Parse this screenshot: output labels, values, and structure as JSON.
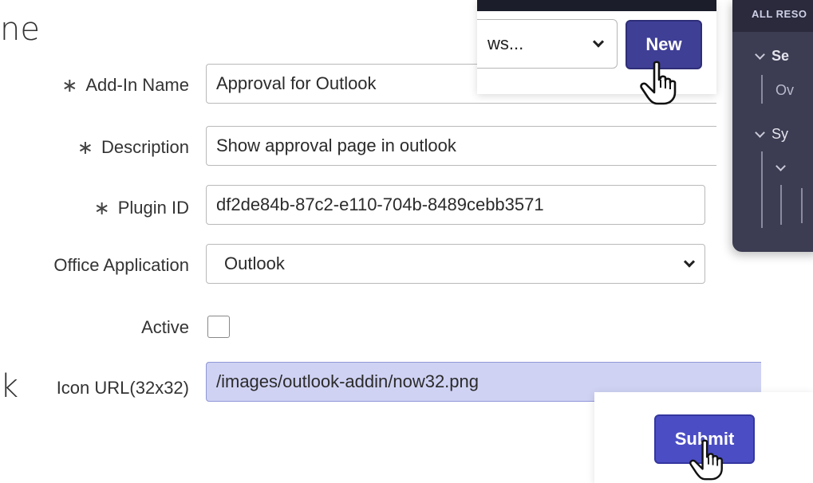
{
  "background": {
    "word_top": "ne",
    "word_mid": "k"
  },
  "form": {
    "add_in_name": {
      "label": "Add-In Name",
      "required_mark": "∗",
      "value": "Approval for Outlook"
    },
    "description": {
      "label": "Description",
      "required_mark": "∗",
      "value": "Show approval page in outlook"
    },
    "plugin_id": {
      "label": "Plugin ID",
      "required_mark": "∗",
      "value": "df2de84b-87c2-e110-704b-8489cebb3571"
    },
    "office_application": {
      "label": "Office Application",
      "value": "Outlook"
    },
    "active": {
      "label": "Active",
      "checked": false
    },
    "icon_url": {
      "label": "Icon URL(32x32)",
      "value": "/images/outlook-addin/now32.png"
    }
  },
  "list_toolbar": {
    "views_select": "ws...",
    "new_label": "New"
  },
  "nav_panel": {
    "header": "ALL RESO",
    "items": [
      "Se",
      "Ov",
      "Sy"
    ]
  },
  "actions": {
    "submit_label": "Submit"
  },
  "colors": {
    "primary_button": "#4b4dc4",
    "new_button": "#3f3f96",
    "readonly_field": "#cfd2f3",
    "panel_bg": "#3c3c52"
  }
}
